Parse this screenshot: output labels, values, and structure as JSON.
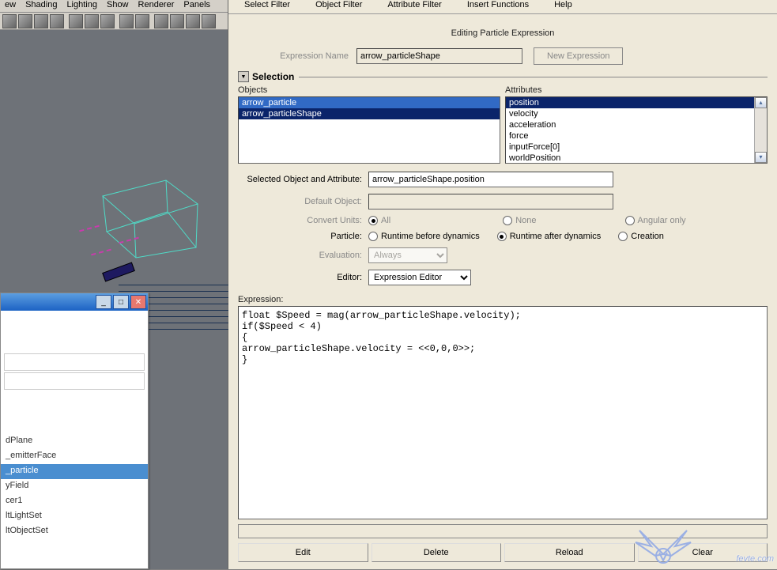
{
  "viewport_menu": [
    "ew",
    "Shading",
    "Lighting",
    "Show",
    "Renderer",
    "Panels"
  ],
  "outliner": {
    "items": [
      "dPlane",
      "_emitterFace",
      "_particle",
      "yField",
      "cer1",
      "ltLightSet",
      "ltObjectSet"
    ],
    "selected_index": 2
  },
  "expr": {
    "menu": [
      "Select Filter",
      "Object Filter",
      "Attribute Filter",
      "Insert Functions",
      "Help"
    ],
    "title": "Editing Particle Expression",
    "name_label": "Expression Name",
    "name_value": "arrow_particleShape",
    "new_btn": "New Expression",
    "selection_title": "Selection",
    "objects_label": "Objects",
    "attributes_label": "Attributes",
    "objects": [
      "arrow_particle",
      "arrow_particleShape"
    ],
    "objects_selected": 1,
    "attributes": [
      "position",
      "velocity",
      "acceleration",
      "force",
      "inputForce[0]",
      "worldPosition"
    ],
    "attributes_selected": 0,
    "sel_obj_attr_label": "Selected Object and Attribute:",
    "sel_obj_attr_value": "arrow_particleShape.position",
    "default_obj_label": "Default Object:",
    "convert_label": "Convert Units:",
    "convert_opts": [
      "All",
      "None",
      "Angular only"
    ],
    "particle_label": "Particle:",
    "particle_opts": [
      "Runtime before dynamics",
      "Runtime after dynamics",
      "Creation"
    ],
    "particle_selected": 1,
    "eval_label": "Evaluation:",
    "eval_value": "Always",
    "editor_label": "Editor:",
    "editor_value": "Expression Editor",
    "expression_label": "Expression:",
    "expression_code": "float $Speed = mag(arrow_particleShape.velocity);\nif($Speed < 4)\n{\narrow_particleShape.velocity = <<0,0,0>>;\n}",
    "buttons": [
      "Edit",
      "Delete",
      "Reload",
      "Clear"
    ]
  },
  "watermark": "fevte.com"
}
